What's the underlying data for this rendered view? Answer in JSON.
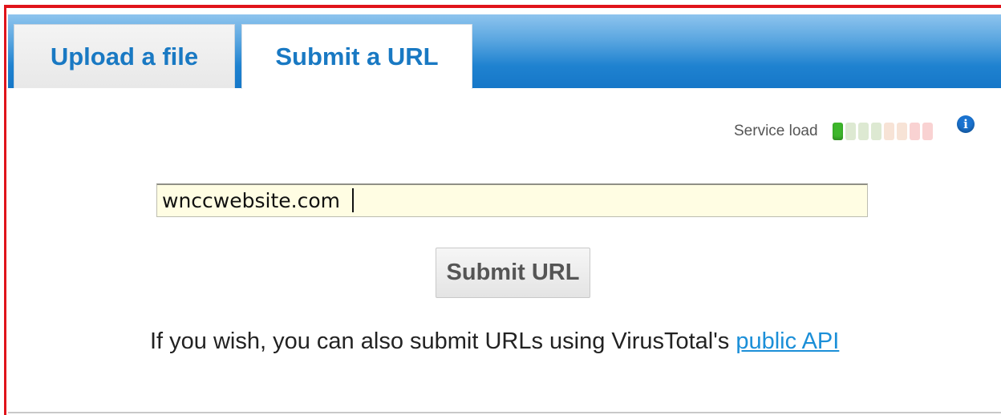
{
  "tabs": {
    "upload_label": "Upload a file",
    "url_label": "Submit a URL",
    "active": "url"
  },
  "service_load": {
    "label": "Service load",
    "level": 1,
    "total": 8,
    "bar_colors": [
      "#3db62b",
      "#dde9d2",
      "#dde9d2",
      "#dde9d2",
      "#f7e3d6",
      "#f7e3d6",
      "#f9d2d2",
      "#f9d2d2"
    ]
  },
  "info_icon": {
    "glyph": "i",
    "name": "info-icon"
  },
  "url_form": {
    "input_value": "wnccwebsite.com",
    "submit_label": "Submit URL"
  },
  "api_note": {
    "text": "If you wish, you can also submit URLs using VirusTotal's",
    "link_text": "public API"
  },
  "colors": {
    "accent_blue": "#1979c3",
    "tabbar_blue": "#1577c8",
    "input_bg": "#fffde3",
    "link_blue": "#1b8fd8",
    "frame_red": "#e0141b"
  }
}
